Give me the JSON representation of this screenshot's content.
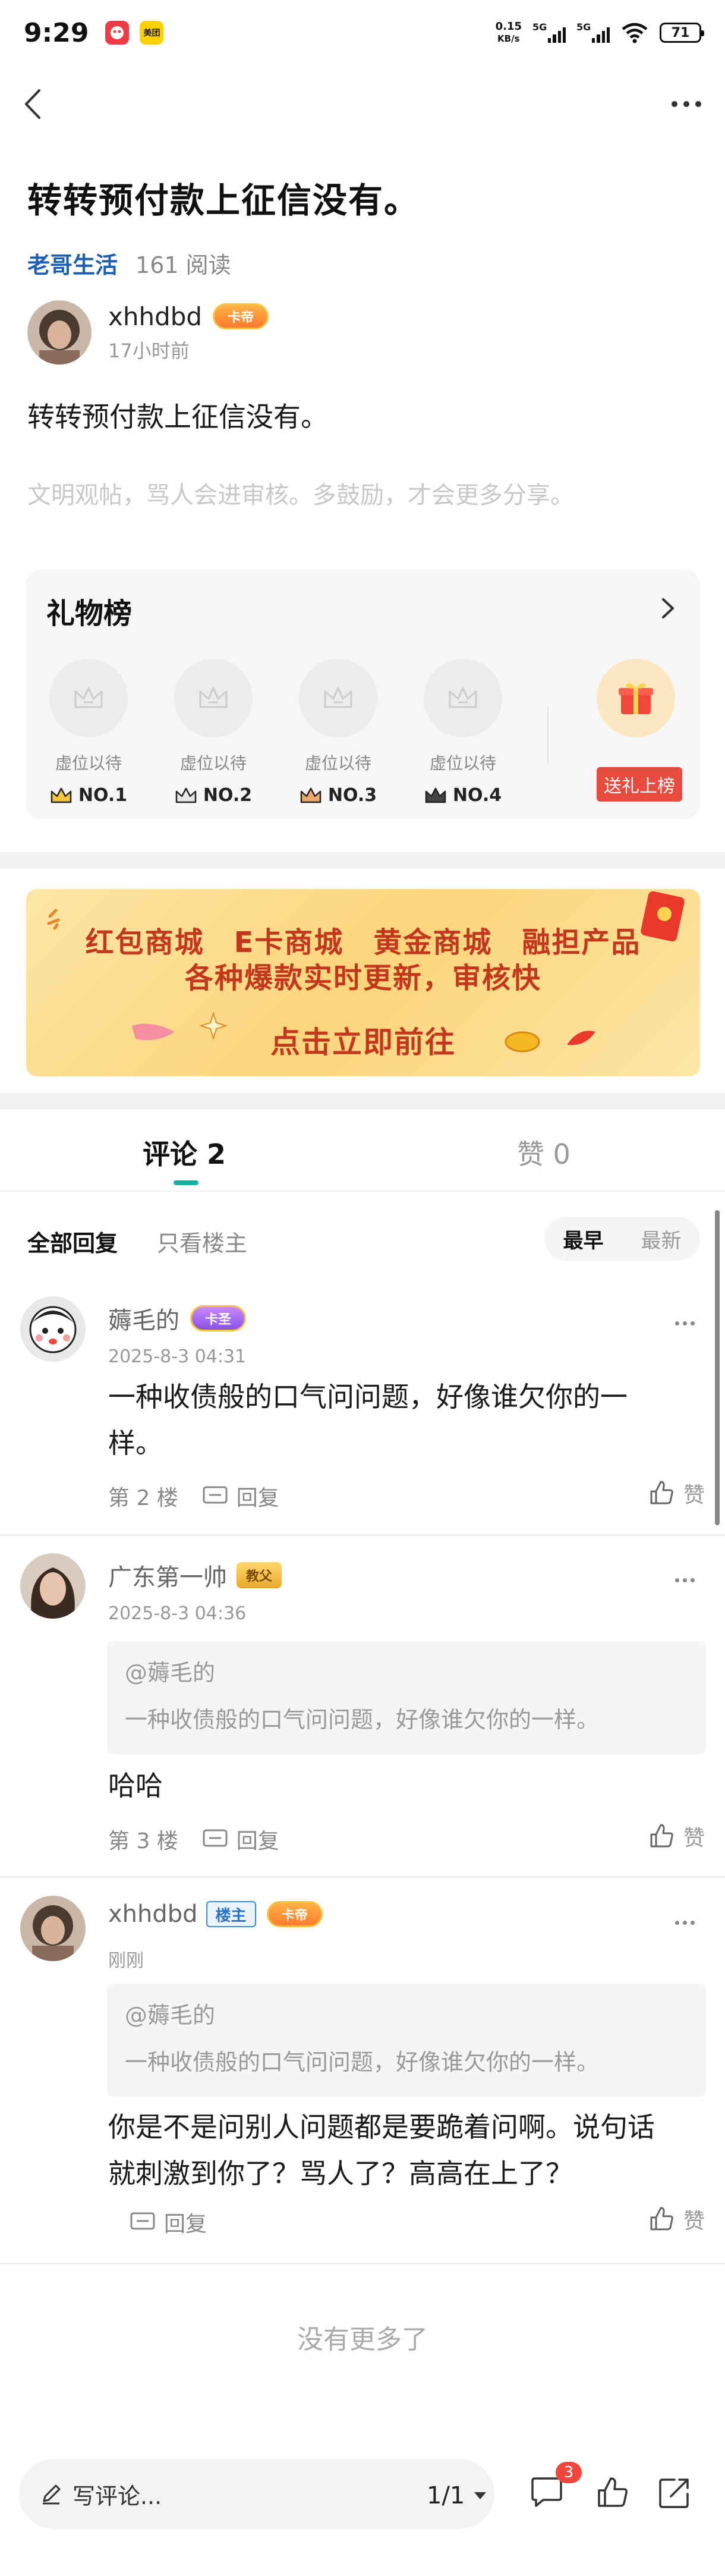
{
  "status_bar": {
    "time": "9:29",
    "app_badge": "美团",
    "net_speed_value": "0.15",
    "net_speed_unit": "KB/s",
    "signal1_label": "5G",
    "signal2_label": "5G",
    "battery": "71"
  },
  "post": {
    "title": "转转预付款上征信没有。",
    "forum": "老哥生活",
    "reads": "161 阅读",
    "author": "xhhdbd",
    "author_badge": "卡帝",
    "time": "17小时前",
    "body": "转转预付款上征信没有。",
    "hint": "文明观帖，骂人会进审核。多鼓励，才会更多分享。"
  },
  "gift_board": {
    "title": "礼物榜",
    "slots": [
      {
        "label": "虚位以待",
        "rank": "NO.1"
      },
      {
        "label": "虚位以待",
        "rank": "NO.2"
      },
      {
        "label": "虚位以待",
        "rank": "NO.3"
      },
      {
        "label": "虚位以待",
        "rank": "NO.4"
      }
    ],
    "send_label": "送礼上榜"
  },
  "banner": {
    "items": [
      "红包商城",
      "E卡商城",
      "黄金商城",
      "融担产品"
    ],
    "line2": "各种爆款实时更新，审核快",
    "cta": "点击立即前往"
  },
  "tabs": {
    "comments": "评论 2",
    "likes": "赞 0"
  },
  "filters": {
    "all": "全部回复",
    "owner_only": "只看楼主",
    "sort_early": "最早",
    "sort_new": "最新"
  },
  "comments": [
    {
      "name": "薅毛的",
      "badge": "卡圣",
      "time": "2025-8-3 04:31",
      "text_line1": "一种收债般的口气问问题，好像谁欠你的一",
      "text_line2": "样。",
      "floor": "第 2 楼",
      "reply": "回复",
      "like": "赞"
    },
    {
      "name": "广东第一帅",
      "badge": "教父",
      "time": "2025-8-3 04:36",
      "quote_user": "@薅毛的",
      "quote_text": "一种收债般的口气问问题，好像谁欠你的一样。",
      "text_line1": "哈哈",
      "floor": "第 3 楼",
      "reply": "回复",
      "like": "赞"
    },
    {
      "name": "xhhdbd",
      "owner_badge": "楼主",
      "badge": "卡帝",
      "time": "刚刚",
      "quote_user": "@薅毛的",
      "quote_text": "一种收债般的口气问问题，好像谁欠你的一样。",
      "text_line1": "你是不是问别人问题都是要跪着问啊。说句话",
      "text_line2": "就刺激到你了？骂人了？高高在上了？",
      "reply": "回复",
      "like": "赞"
    }
  ],
  "no_more": "没有更多了",
  "bottom_bar": {
    "write_label": "写评论...",
    "page": "1/1",
    "comment_count": "3"
  },
  "colors": {
    "accent": "#18b2a0",
    "forum": "#1a5fb4",
    "red": "#e84a3d"
  }
}
